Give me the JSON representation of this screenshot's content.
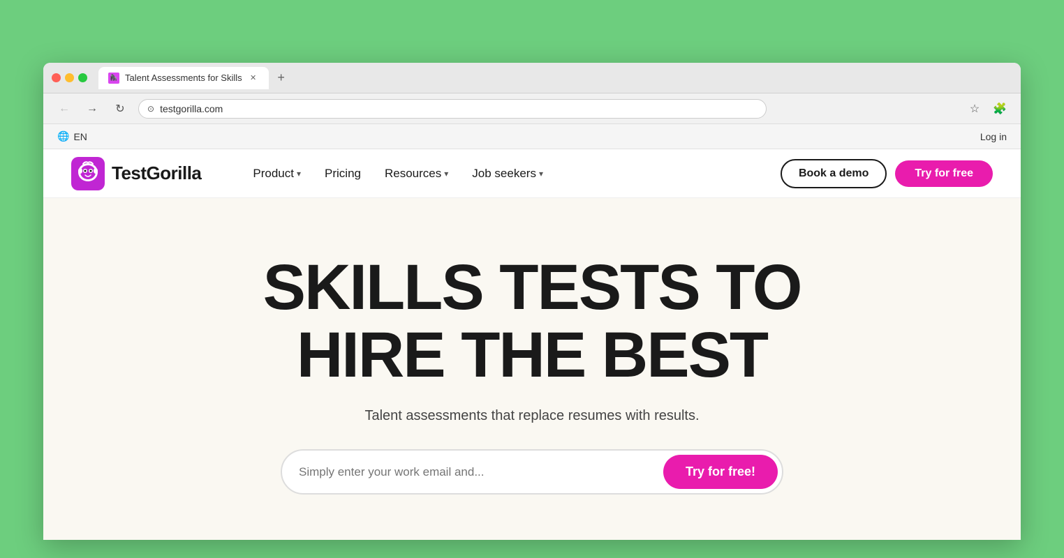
{
  "browser": {
    "tab_title": "Talent Assessments for Skills",
    "url": "testgorilla.com",
    "new_tab_label": "+",
    "lang": "EN"
  },
  "langbar": {
    "lang_label": "EN",
    "login_label": "Log in"
  },
  "nav": {
    "logo_text": "TestGorilla",
    "product_label": "Product",
    "pricing_label": "Pricing",
    "resources_label": "Resources",
    "job_seekers_label": "Job seekers",
    "book_demo_label": "Book a demo",
    "try_free_label": "Try for free"
  },
  "hero": {
    "title_line1": "SKILLS TESTS TO",
    "title_line2": "HIRE THE BEST",
    "subtitle": "Talent assessments that replace resumes with results.",
    "email_placeholder": "Simply enter your work email and...",
    "cta_label": "Try for free!"
  },
  "colors": {
    "brand_pink": "#e91cad",
    "background_green": "#6dce7e",
    "hero_bg": "#faf8f2"
  }
}
